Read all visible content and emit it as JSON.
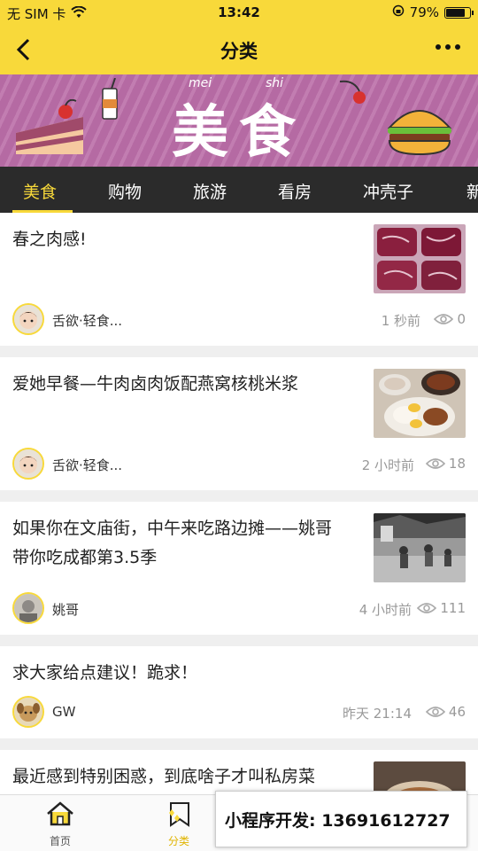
{
  "status_bar": {
    "carrier": "无 SIM 卡",
    "time": "13:42",
    "battery": "79%",
    "battery_level": 0.79
  },
  "nav": {
    "title": "分类"
  },
  "banner": {
    "title": "美食",
    "pinyin_1": "mei",
    "pinyin_2": "shi"
  },
  "tabs": [
    "美食",
    "购物",
    "旅游",
    "看房",
    "冲壳子",
    "新"
  ],
  "active_tab": 0,
  "articles": [
    {
      "title": "春之肉感!",
      "author": "舌欲·轻食...",
      "time": "1 秒前",
      "views": "0"
    },
    {
      "title": "爱她早餐—牛肉卤肉饭配燕窝核桃米浆",
      "author": "舌欲·轻食...",
      "time": "2 小时前",
      "views": "18"
    },
    {
      "title_line1": "如果你在文庙街，中午来吃路边摊——姚哥",
      "title_line2": "带你吃成都第3.5季",
      "author": "姚哥",
      "time": "4 小时前",
      "views": "111"
    },
    {
      "title": "求大家给点建议！跪求！",
      "author": "GW",
      "time": "昨天 21:14",
      "views": "46"
    },
    {
      "title": "最近感到特别困惑，到底啥子才叫私房菜"
    }
  ],
  "tabbar": {
    "home": "首页",
    "category": "分类"
  },
  "overlay": {
    "text": "小程序开发: 13691612727"
  },
  "colors": {
    "accent": "#f8d93a",
    "tabs_bg": "#2b2b2b",
    "banner": "#b56aa3"
  }
}
